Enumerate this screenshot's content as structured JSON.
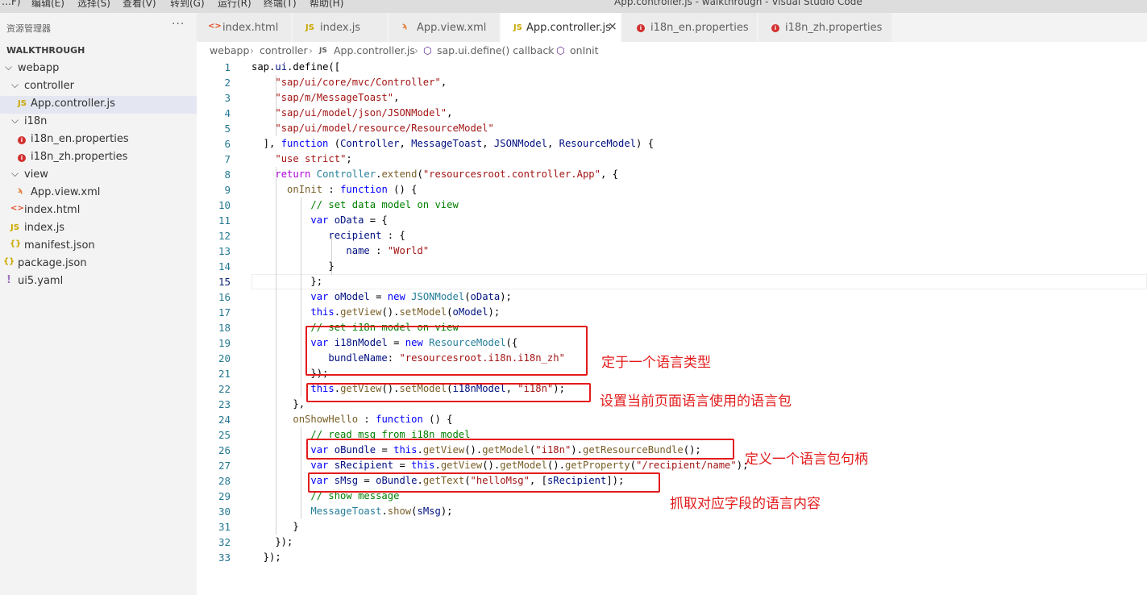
{
  "menubar": {
    "items": [
      "…F)",
      "编辑(E)",
      "选择(S)",
      "查看(V)",
      "转到(G)",
      "运行(R)",
      "终端(T)",
      "帮助(H)"
    ],
    "window_title": "App.controller.js - walkthrough - Visual Studio Code"
  },
  "sidebar": {
    "title": "资源管理器",
    "more": "···",
    "section": "WALKTHROUGH",
    "items": [
      {
        "label": "webapp",
        "kind": "folder"
      },
      {
        "label": "controller",
        "kind": "folder"
      },
      {
        "label": "App.controller.js",
        "kind": "js",
        "icon": "JS"
      },
      {
        "label": "i18n",
        "kind": "folder"
      },
      {
        "label": "i18n_en.properties",
        "kind": "properties"
      },
      {
        "label": "i18n_zh.properties",
        "kind": "properties"
      },
      {
        "label": "view",
        "kind": "folder"
      },
      {
        "label": "App.view.xml",
        "kind": "xml"
      },
      {
        "label": "index.html",
        "kind": "html"
      },
      {
        "label": "index.js",
        "kind": "js",
        "icon": "JS"
      },
      {
        "label": "manifest.json",
        "kind": "json",
        "icon": "{}"
      },
      {
        "label": "package.json",
        "kind": "json",
        "icon": "{}"
      },
      {
        "label": "ui5.yaml",
        "kind": "yaml",
        "icon": "!"
      }
    ]
  },
  "tabs": [
    {
      "label": "index.html",
      "icon": "<>"
    },
    {
      "label": "index.js",
      "icon": "JS"
    },
    {
      "label": "App.view.xml",
      "icon": "rss-icon"
    },
    {
      "label": "App.controller.js",
      "icon": "JS",
      "active": true,
      "close": "×"
    },
    {
      "label": "i18n_en.properties",
      "icon": "info-dot-icon"
    },
    {
      "label": "i18n_zh.properties",
      "icon": "info-dot-icon"
    }
  ],
  "breadcrumb": [
    "webapp",
    "controller",
    "App.controller.js",
    "sap.ui.define() callback",
    "onInit"
  ],
  "editor": {
    "line_numbers": [
      "1",
      "2",
      "3",
      "4",
      "5",
      "6",
      "7",
      "8",
      "9",
      "10",
      "11",
      "12",
      "13",
      "14",
      "15",
      "16",
      "17",
      "18",
      "19",
      "20",
      "21",
      "22",
      "23",
      "24",
      "25",
      "26",
      "27",
      "28",
      "29",
      "30",
      "31",
      "32",
      "33"
    ],
    "current_line": "15"
  },
  "annotations": [
    "定于一个语言类型",
    "设置当前页面语言使用的语言包",
    "定义一个语言包句柄",
    "抓取对应字段的语言内容"
  ],
  "colors": {
    "annotation_red": "#e31b1b",
    "sidebar_bg": "#f3f3f3",
    "active_row_bg": "#e4e6f1",
    "keyword_blue": "#0000ff",
    "string_red": "#a31515",
    "comment_green": "#008000"
  }
}
